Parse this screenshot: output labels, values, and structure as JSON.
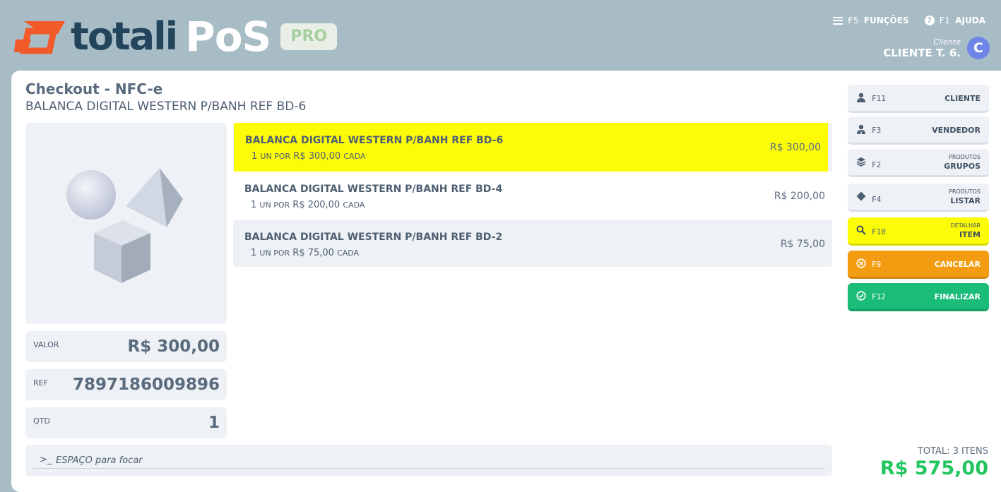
{
  "header": {
    "logo": {
      "brand": "totali",
      "product": "PoS",
      "badge": "PRO"
    },
    "nav": [
      {
        "key": "F5",
        "label": "FUNÇÕES",
        "icon": "menu-icon"
      },
      {
        "key": "F1",
        "label": "AJUDA",
        "icon": "help-icon"
      }
    ],
    "client": {
      "label": "Cliente",
      "name": "CLIENTE T. 6.",
      "avatar": "C"
    }
  },
  "checkout": {
    "title": "Checkout - NFC-e",
    "subtitle": "BALANCA DIGITAL WESTERN P/BANH REF BD-6",
    "fields": {
      "valor": {
        "label": "VALOR",
        "value": "R$ 300,00"
      },
      "ref": {
        "label": "REF",
        "value": "7897186009896"
      },
      "qtd": {
        "label": "QTD",
        "value": "1"
      }
    },
    "items": [
      {
        "name": "BALANCA DIGITAL WESTERN P/BANH REF BD-6",
        "qty": "1",
        "unit": "UN POR",
        "unit_price": "R$ 300,00",
        "each": "CADA",
        "price": "R$ 300,00",
        "selected": true
      },
      {
        "name": "BALANCA DIGITAL WESTERN P/BANH REF BD-4",
        "qty": "1",
        "unit": "UN POR",
        "unit_price": "R$ 200,00",
        "each": "CADA",
        "price": "R$ 200,00",
        "selected": false
      },
      {
        "name": "BALANCA DIGITAL WESTERN P/BANH REF BD-2",
        "qty": "1",
        "unit": "UN POR",
        "unit_price": "R$ 75,00",
        "each": "CADA",
        "price": "R$ 75,00",
        "selected": false
      }
    ],
    "command": {
      "prompt": ">_",
      "placeholder": "ESPAÇO para focar"
    }
  },
  "sidebar": {
    "buttons": [
      {
        "key": "F11",
        "label": "CLIENTE",
        "sub": "",
        "icon": "user-icon"
      },
      {
        "key": "F3",
        "label": "VENDEDOR",
        "sub": "",
        "icon": "seller-icon"
      },
      {
        "key": "F2",
        "label": "GRUPOS",
        "sub": "PRODUTOS",
        "icon": "layers-icon"
      },
      {
        "key": "F4",
        "label": "LISTAR",
        "sub": "PRODUTOS",
        "icon": "diamond-icon"
      },
      {
        "key": "F10",
        "label": "ITEM",
        "sub": "DETALHAR",
        "icon": "search-icon"
      },
      {
        "key": "F9",
        "label": "CANCELAR",
        "sub": "",
        "icon": "cancel-icon"
      },
      {
        "key": "F12",
        "label": "FINALIZAR",
        "sub": "",
        "icon": "check-icon"
      }
    ]
  },
  "total": {
    "label": "TOTAL: 3 ITENS",
    "value": "R$ 575,00"
  },
  "colors": {
    "background": "#a8bcc6",
    "selected_row": "#fcfc09",
    "cancel": "#f39c12",
    "finalize": "#1abc78",
    "total": "#22c55e",
    "avatar": "#6e86e8",
    "logo_mark": "#f25a2a"
  }
}
